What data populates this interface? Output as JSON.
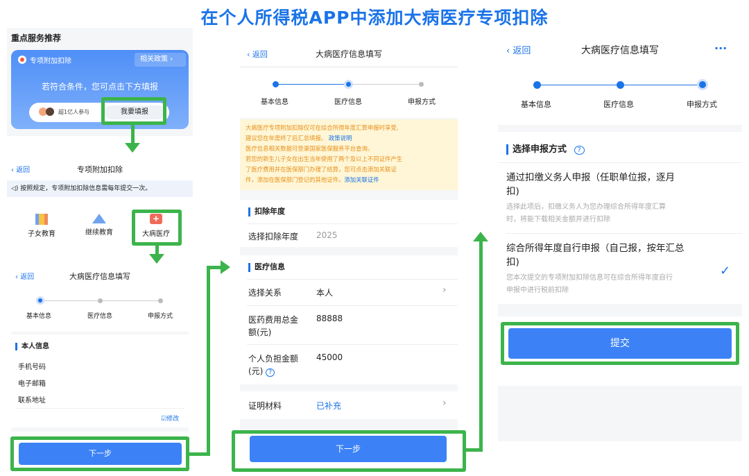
{
  "title": "在个人所得税APP中添加大病医疗专项扣除",
  "panel1": {
    "header": "重点服务推荐",
    "card_title": "专项附加扣除",
    "card_policy": "相关政策",
    "card_desc": "若符合条件，您可点击下方填报",
    "people_text": "超1亿人参与",
    "fill_button": "我要填报"
  },
  "panel2": {
    "back": "返回",
    "title": "专项附加扣除",
    "notice": "按照规定，专项附加扣除信息需每年提交一次。",
    "categories": [
      "子女教育",
      "继续教育",
      "大病医疗"
    ]
  },
  "panel3": {
    "back": "返回",
    "title": "大病医疗信息填写",
    "steps": [
      "基本信息",
      "医疗信息",
      "申报方式"
    ],
    "section": "本人信息",
    "fields": [
      "手机号码",
      "电子邮箱",
      "联系地址"
    ],
    "edit": "修改",
    "next": "下一步"
  },
  "panel4": {
    "back": "返回",
    "title": "大病医疗信息填写",
    "steps": [
      "基本信息",
      "医疗信息",
      "申报方式"
    ],
    "notice_lines": [
      "大病医疗专项附加扣除仅可在综合所得年度汇算申报时享受,",
      "建议您在年度终了后汇总填报。",
      "医疗信息相关数据可登录国家医保服务平台查询。",
      "若您的新生儿子女在出生当年使用了两个及以上不同证件产生",
      "了医疗费用并在医保部门办理了结算，您可点击添加关联证",
      "件，添加在医保部门登记的其他证件。"
    ],
    "policy_link": "政策说明",
    "add_link": "添加关联证件",
    "sec1": "扣除年度",
    "year_label": "选择扣除年度",
    "year_value": "2025",
    "sec2": "医疗信息",
    "relation_label": "选择关系",
    "relation_value": "本人",
    "total_label_1": "医药费用总金",
    "total_label_2": "额(元)",
    "total_value": "88888",
    "personal_label_1": "个人负担金额",
    "personal_label_2": "(元)",
    "personal_value": "45000",
    "proof_label": "证明材料",
    "proof_value": "已补充",
    "next": "下一步"
  },
  "panel5": {
    "back": "返回",
    "title": "大病医疗信息填写",
    "more": "···",
    "steps": [
      "基本信息",
      "医疗信息",
      "申报方式"
    ],
    "section": "选择申报方式",
    "opt1_title_1": "通过扣缴义务人申报（任职单位报，逐月",
    "opt1_title_2": "扣)",
    "opt1_desc_1": "选择此项后，扣缴义务人为您办理综合所得年度汇算",
    "opt1_desc_2": "时，将能下载相关金额并进行扣除",
    "opt2_title_1": "综合所得年度自行申报（自己报，按年汇总",
    "opt2_title_2": "扣)",
    "opt2_desc_1": "您本次提交的专项附加扣除信息可在综合所得年度自行",
    "opt2_desc_2": "申报中进行税前扣除",
    "submit": "提交"
  },
  "colors": {
    "accent": "#1a73e8",
    "highlight": "#3cb44b",
    "button": "#3c82f6",
    "notice_bg": "#fef6d6",
    "notice_text": "#e8901a"
  }
}
